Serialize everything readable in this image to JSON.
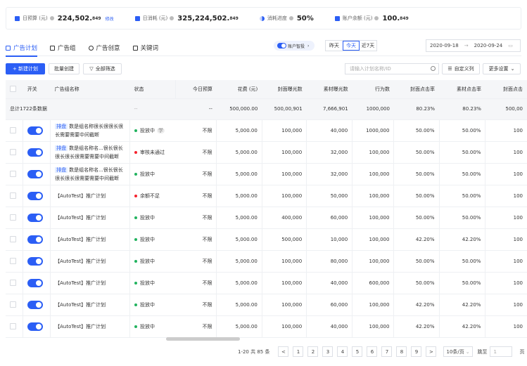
{
  "stats": [
    {
      "label": "日预算 (元)",
      "value": "224,502.",
      "decimal": "849",
      "link": "修改"
    },
    {
      "label": "日消耗 (元)",
      "value": "325,224,502.",
      "decimal": "849"
    },
    {
      "label": "消耗进度",
      "value": "50%",
      "decimal": ""
    },
    {
      "label": "账户余额 (元)",
      "value": "100.",
      "decimal": "849"
    }
  ],
  "tabs": [
    "广告计划",
    "广告组",
    "广告创意",
    "关键词"
  ],
  "smart_label": "账户智投",
  "date_seg": [
    "昨天",
    "今天",
    "近7天"
  ],
  "date_start": "2020-09-18",
  "date_end": "2020-09-24",
  "toolbar": {
    "new": "+ 新建计划",
    "batch": "批量创建",
    "filter": "全部筛选",
    "search_placeholder": "请输入计划名称/ID",
    "columns": "自定义列",
    "more": "更多设置"
  },
  "headers": [
    "开关",
    "广告组名称",
    "状态",
    "今日预算",
    "花费 (元)",
    "封面曝光数",
    "素材曝光数",
    "行为数",
    "封面点击率",
    "素材点击率",
    "封面点击"
  ],
  "total": {
    "label": "总计1722条数据",
    "status": "--",
    "budget": "--",
    "cells": [
      "500,000.00",
      "500,00,901",
      "7,666,901",
      "1000,000",
      "80.23%",
      "80.23%",
      "500,00"
    ]
  },
  "rows": [
    {
      "tag": "排盘",
      "name": "数是组名称很长很很长很长需要需要中间截断",
      "status": "投放中",
      "color": "#21b35e",
      "badge": "学",
      "budget": "不限",
      "cells": [
        "5,000.00",
        "100,000",
        "40,000",
        "1000,000",
        "50.00%",
        "50.00%",
        "100"
      ]
    },
    {
      "tag": "排盘",
      "name": "数是组名称名...很长很长很长很长很需要需要中间截断",
      "status": "审核未通过",
      "color": "#f5222d",
      "budget": "不限",
      "cells": [
        "5,000.00",
        "100,000",
        "32,000",
        "100,000",
        "50.00%",
        "50.00%",
        "100"
      ]
    },
    {
      "tag": "排盘",
      "name": "数是组名称名...很长很长很长很长很需要需要中间截断",
      "status": "投放中",
      "color": "#21b35e",
      "budget": "不限",
      "cells": [
        "5,000.00",
        "100,000",
        "32,000",
        "100,000",
        "50.00%",
        "50.00%",
        "100"
      ]
    },
    {
      "name": "【AutoTest】推广计划",
      "status": "余额不足",
      "color": "#f5222d",
      "budget": "不限",
      "cells": [
        "5,000.00",
        "100,000",
        "50,000",
        "100,000",
        "50.00%",
        "50.00%",
        "100"
      ]
    },
    {
      "name": "【AutoTest】推广计划",
      "status": "投放中",
      "color": "#21b35e",
      "budget": "不限",
      "cells": [
        "5,000.00",
        "400,000",
        "60,000",
        "100,000",
        "50.00%",
        "50.00%",
        "100"
      ]
    },
    {
      "name": "【AutoTest】推广计划",
      "status": "投放中",
      "color": "#21b35e",
      "budget": "不限",
      "cells": [
        "5,000.00",
        "500,000",
        "10,000",
        "100,000",
        "42.20%",
        "42.20%",
        "100"
      ]
    },
    {
      "name": "【AutoTest】推广计划",
      "status": "投放中",
      "color": "#21b35e",
      "budget": "不限",
      "cells": [
        "5,000.00",
        "100,000",
        "80,000",
        "100,000",
        "50.00%",
        "50.00%",
        "100"
      ]
    },
    {
      "name": "【AutoTest】推广计划",
      "status": "投放中",
      "color": "#21b35e",
      "budget": "不限",
      "cells": [
        "5,000.00",
        "100,000",
        "40,000",
        "600,000",
        "50.00%",
        "50.00%",
        "100"
      ]
    },
    {
      "name": "【AutoTest】推广计划",
      "status": "投放中",
      "color": "#21b35e",
      "budget": "不限",
      "cells": [
        "5,000.00",
        "100,000",
        "60,000",
        "100,000",
        "42.20%",
        "42.20%",
        "100"
      ]
    },
    {
      "name": "【AutoTest】推广计划",
      "status": "投放中",
      "color": "#21b35e",
      "budget": "不限",
      "cells": [
        "5,000.00",
        "100,000",
        "40,000",
        "100,000",
        "42.20%",
        "42.20%",
        "100"
      ]
    }
  ],
  "pagination": {
    "summary": "1-20 共 85 条",
    "prev": "<",
    "next": ">",
    "pages": [
      "1",
      "2",
      "3",
      "4",
      "5",
      "6",
      "7",
      "8",
      "9"
    ],
    "size": "10条/页",
    "jump_label": "跳至",
    "jump_value": "1",
    "page_unit": "页"
  }
}
